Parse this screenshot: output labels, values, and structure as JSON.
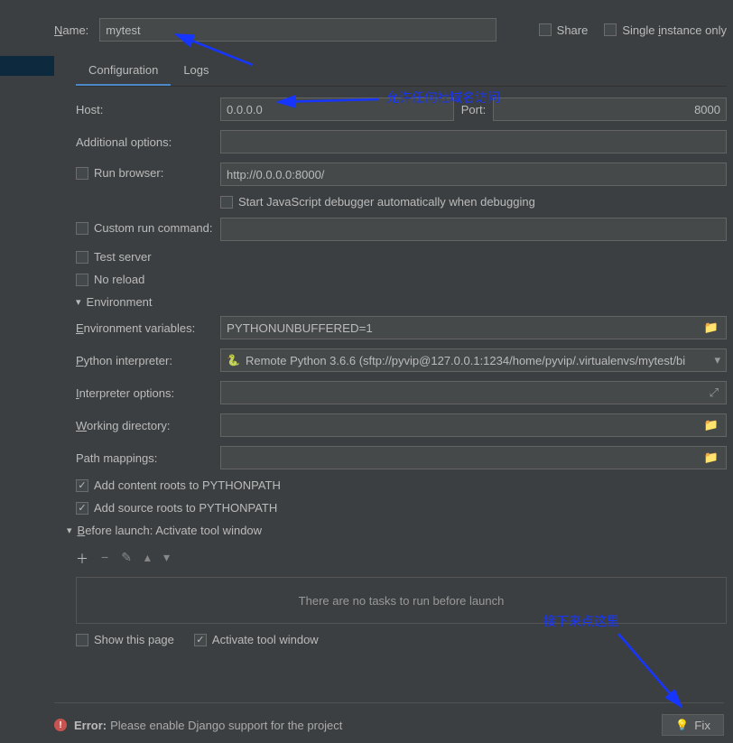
{
  "header": {
    "name_label": "Name:",
    "name_value": "mytest",
    "share_label": "Share",
    "single_instance_label": "Single instance only",
    "share_checked": false,
    "single_instance_checked": false
  },
  "tabs": {
    "configuration": "Configuration",
    "logs": "Logs",
    "active": "configuration"
  },
  "config": {
    "host_label": "Host:",
    "host_value": "0.0.0.0",
    "port_label": "Port:",
    "port_value": "8000",
    "additional_options_label": "Additional options:",
    "additional_options_value": "",
    "run_browser_label": "Run browser:",
    "run_browser_value": "http://0.0.0.0:8000/",
    "run_browser_checked": false,
    "start_js_label": "Start JavaScript debugger automatically when debugging",
    "start_js_checked": false,
    "custom_run_label": "Custom run command:",
    "custom_run_value": "",
    "custom_run_checked": false,
    "test_server_label": "Test server",
    "test_server_checked": false,
    "no_reload_label": "No reload",
    "no_reload_checked": false
  },
  "env": {
    "section_title": "Environment",
    "env_vars_label": "Environment variables:",
    "env_vars_value": "PYTHONUNBUFFERED=1",
    "interpreter_label": "Python interpreter:",
    "interpreter_value": "Remote Python 3.6.6 (sftp://pyvip@127.0.0.1:1234/home/pyvip/.virtualenvs/mytest/bi",
    "interpreter_options_label": "Interpreter options:",
    "interpreter_options_value": "",
    "working_dir_label": "Working directory:",
    "working_dir_value": "",
    "path_mappings_label": "Path mappings:",
    "path_mappings_value": "",
    "add_content_roots_label": "Add content roots to PYTHONPATH",
    "add_content_roots_checked": true,
    "add_source_roots_label": "Add source roots to PYTHONPATH",
    "add_source_roots_checked": true
  },
  "before_launch": {
    "section_title": "Before launch: Activate tool window",
    "empty_text": "There are no tasks to run before launch",
    "show_page_label": "Show this page",
    "show_page_checked": false,
    "activate_tool_label": "Activate tool window",
    "activate_tool_checked": true
  },
  "error": {
    "label": "Error:",
    "message": "Please enable Django support for the project",
    "fix_button": "Fix"
  },
  "annotations": {
    "host_note": "允许任何社域名访问",
    "fix_note": "接下来点这里"
  }
}
